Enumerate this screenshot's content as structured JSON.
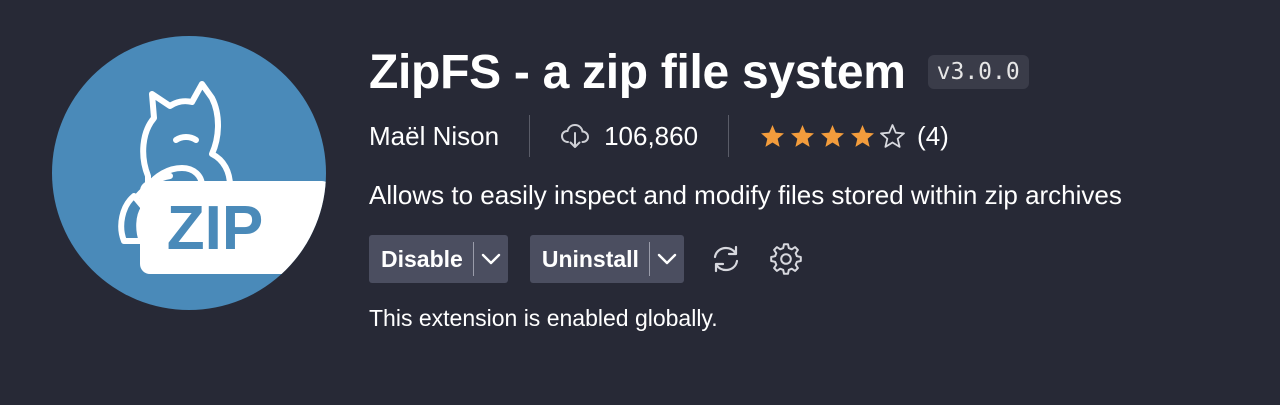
{
  "extension": {
    "name": "ZipFS - a zip file system",
    "version": "v3.0.0",
    "publisher": "Maël Nison",
    "install_count": "106,860",
    "rating": 4,
    "rating_max": 5,
    "rating_count": "(4)",
    "description": "Allows to easily inspect and modify files stored within zip archives",
    "logo_text": "ZIP"
  },
  "actions": {
    "disable_label": "Disable",
    "uninstall_label": "Uninstall"
  },
  "status": {
    "text": "This extension is enabled globally."
  },
  "icons": {
    "downloads": "cloud-download-icon",
    "sync": "sync-icon",
    "settings": "gear-icon",
    "dropdown": "chevron-down-icon",
    "star": "star-icon"
  },
  "colors": {
    "background": "#272936",
    "logo_circle": "#4a8ab9",
    "star_filled": "#f39c3c",
    "button": "#4b4e60"
  }
}
